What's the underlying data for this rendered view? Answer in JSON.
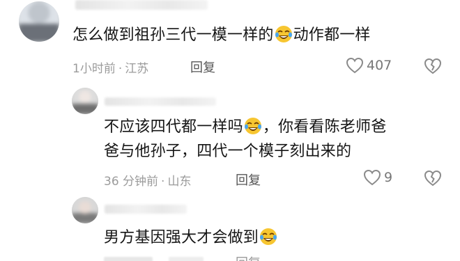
{
  "comments": [
    {
      "text_before": "怎么做到祖孙三代一模一样的",
      "text_after": "动作都一样",
      "emoji": "laughing-crying-emoji",
      "time": "1小时前",
      "location": "江苏",
      "reply_label": "回复",
      "likes": "407"
    },
    {
      "line1_before": "不应该四代都一样吗",
      "line1_after": "，你看看陈老师爸",
      "line2": "爸与他孙子，四代一个模子刻出来的",
      "emoji": "laughing-crying-emoji",
      "time": "36 分钟前",
      "location": "山东",
      "reply_label": "回复",
      "likes": "9"
    },
    {
      "text_before": "男方基因强大才会做到",
      "emoji": "laughing-crying-emoji",
      "reply_label": "回复"
    }
  ],
  "separator": "·",
  "colors": {
    "meta": "#9b9b9b",
    "text": "#151515",
    "emoji_face": "#f7c631"
  }
}
